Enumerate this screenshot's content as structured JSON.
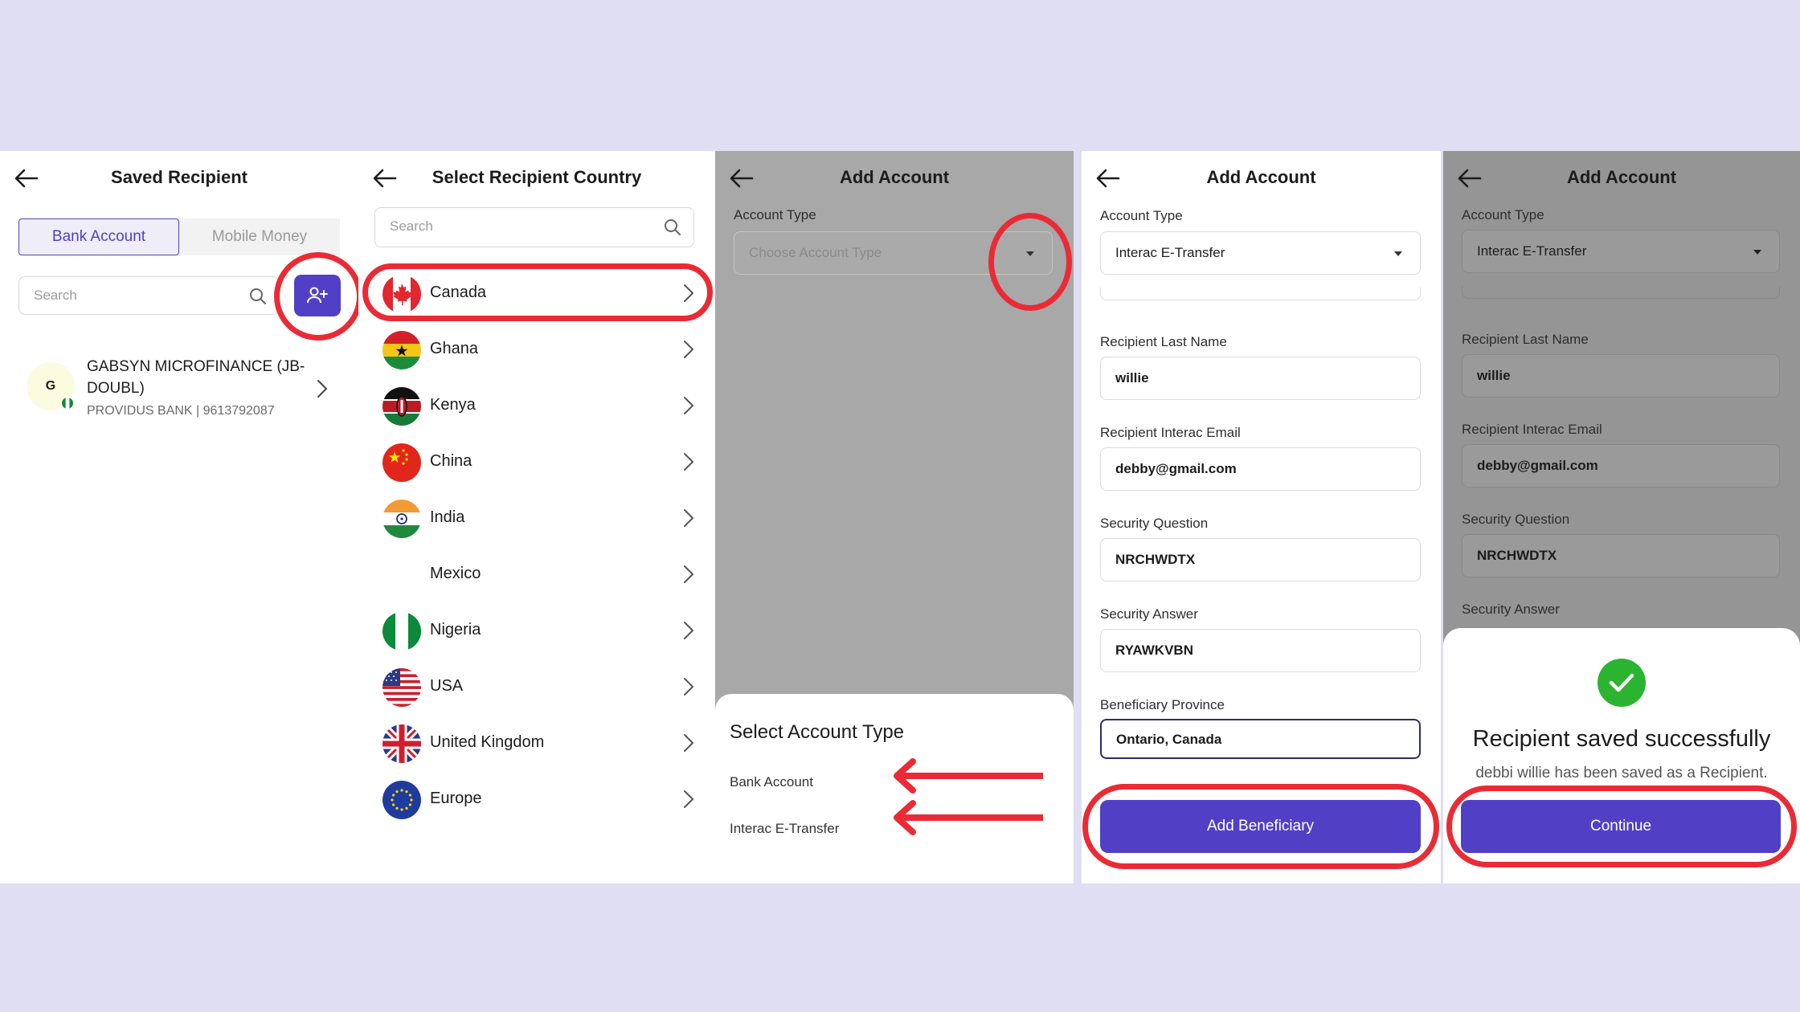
{
  "screens": {
    "saved_recipient": {
      "title": "Saved Recipient",
      "tabs": [
        "Bank Account",
        "Mobile Money"
      ],
      "search_placeholder": "Search",
      "recipient": {
        "initial": "G",
        "name_line1": "GABSYN MICROFINANCE (JB-",
        "name_line2": "DOUBL)",
        "details": "PROVIDUS BANK | 9613792087"
      }
    },
    "select_country": {
      "title": "Select Recipient Country",
      "search_placeholder": "Search",
      "countries": [
        "Canada",
        "Ghana",
        "Kenya",
        "China",
        "India",
        "Mexico",
        "Nigeria",
        "USA",
        "United Kingdom",
        "Europe"
      ]
    },
    "add_account_type": {
      "title": "Add Account",
      "account_type_label": "Account Type",
      "account_type_placeholder": "Choose Account Type",
      "sheet_title": "Select Account Type",
      "options": [
        "Bank Account",
        "Interac E-Transfer"
      ]
    },
    "add_account_form": {
      "title": "Add Account",
      "account_type_label": "Account Type",
      "account_type_value": "Interac E-Transfer",
      "last_name_label": "Recipient Last Name",
      "last_name_value": "willie",
      "email_label": "Recipient Interac Email",
      "email_value": "debby@gmail.com",
      "security_question_label": "Security Question",
      "security_question_value": "NRCHWDTX",
      "security_answer_label": "Security Answer",
      "security_answer_value": "RYAWKVBN",
      "province_label": "Beneficiary Province",
      "province_value": "Ontario, Canada",
      "submit_label": "Add Beneficiary"
    },
    "success": {
      "title": "Add Account",
      "account_type_label": "Account Type",
      "account_type_value": "Interac E-Transfer",
      "last_name_label": "Recipient Last Name",
      "last_name_value": "willie",
      "email_label": "Recipient Interac Email",
      "email_value": "debby@gmail.com",
      "security_question_label": "Security Question",
      "security_question_value": "NRCHWDTX",
      "security_answer_label": "Security Answer",
      "modal_title": "Recipient saved successfully",
      "modal_message": "debbi willie has been saved as a Recipient.",
      "continue_label": "Continue"
    }
  },
  "colors": {
    "background": "#e0def2",
    "primary": "#5140c6",
    "annotation": "#ea2b35",
    "success": "#2ab42f"
  }
}
